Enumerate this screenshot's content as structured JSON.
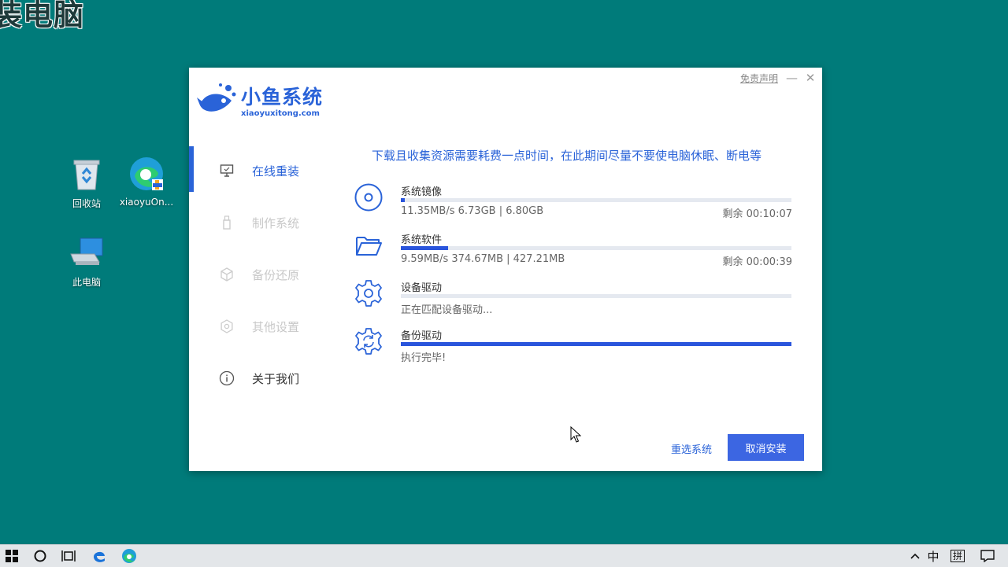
{
  "overlay_text": "装电脑",
  "desktop": {
    "icons": [
      {
        "label": "回收站",
        "icon": "recycle-bin-icon"
      },
      {
        "label": "xiaoyuOn...",
        "icon": "edge-icon"
      },
      {
        "label": "此电脑",
        "icon": "computer-icon"
      }
    ]
  },
  "app": {
    "logo_cn": "小鱼系统",
    "logo_en": "xiaoyuxitong.com",
    "disclaimer": "免责声明",
    "minimize": "—",
    "close": "✕",
    "nav": [
      {
        "label": "在线重装",
        "icon": "monitor-icon",
        "state": "active"
      },
      {
        "label": "制作系统",
        "icon": "usb-icon",
        "state": "disabled"
      },
      {
        "label": "备份还原",
        "icon": "box-icon",
        "state": "disabled"
      },
      {
        "label": "其他设置",
        "icon": "gear-icon",
        "state": "disabled"
      },
      {
        "label": "关于我们",
        "icon": "info-icon",
        "state": "normal"
      }
    ],
    "notice": "下载且收集资源需要耗费一点时间，在此期间尽量不要使电脑休眠、断电等",
    "tasks": [
      {
        "name": "系统镜像",
        "info": "11.35MB/s 6.73GB | 6.80GB",
        "remaining": "剩余 00:10:07",
        "progress": 0.01,
        "icon": "disc-icon"
      },
      {
        "name": "系统软件",
        "info": "9.59MB/s 374.67MB | 427.21MB",
        "remaining": "剩余 00:00:39",
        "progress": 0.12,
        "icon": "folder-icon"
      },
      {
        "name": "设备驱动",
        "info": "正在匹配设备驱动...",
        "remaining": "",
        "progress": 0.0,
        "icon": "gear-icon"
      },
      {
        "name": "备份驱动",
        "info": "执行完毕!",
        "remaining": "",
        "progress": 1.0,
        "icon": "sync-gear-icon"
      }
    ],
    "reselect": "重选系统",
    "cancel": "取消安装",
    "accent_color": "#2a63d8"
  },
  "taskbar": {
    "ime": "中",
    "ime_mode": "拼"
  }
}
